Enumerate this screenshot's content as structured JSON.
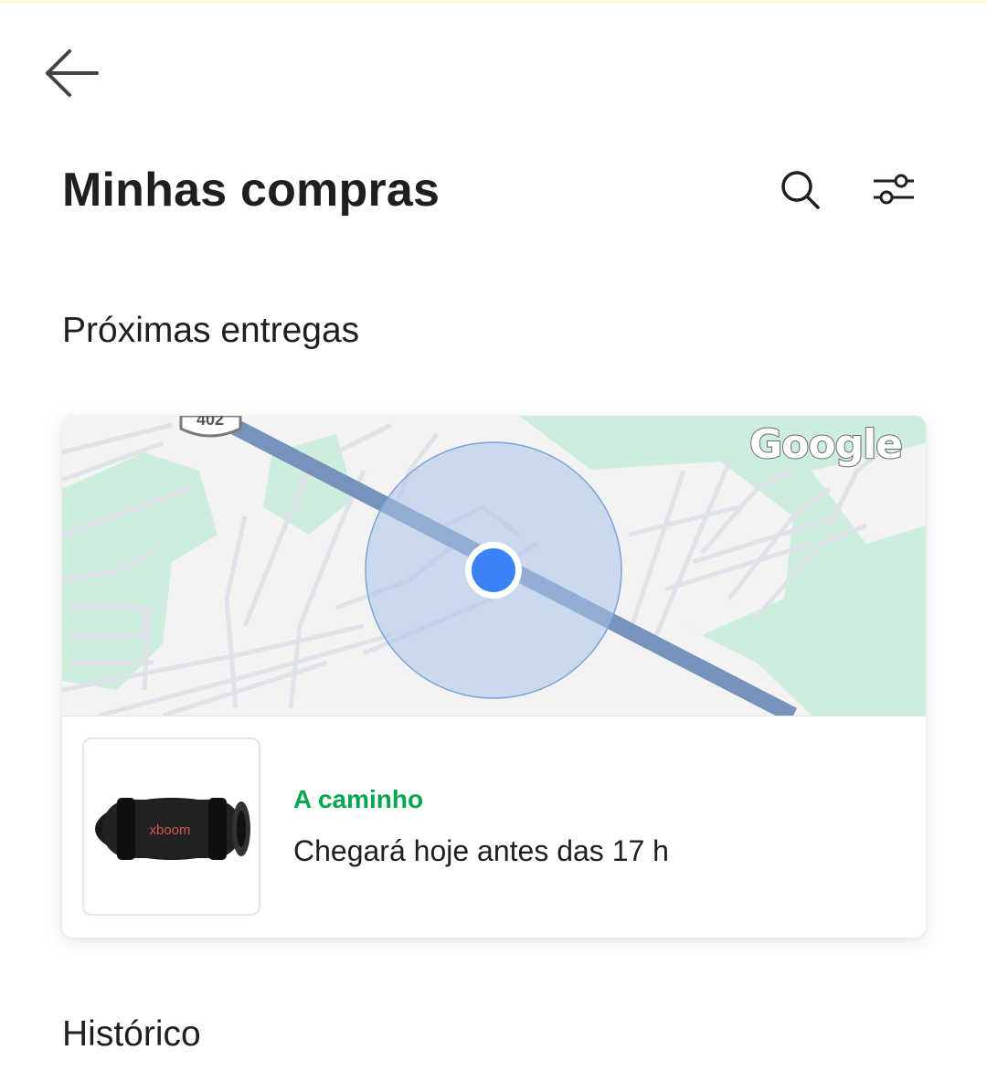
{
  "header": {
    "back_icon": "arrow-left-icon",
    "title": "Minhas compras",
    "search_icon": "search-icon",
    "filter_icon": "sliders-icon"
  },
  "sections": {
    "upcoming_title": "Próximas entregas",
    "history_title": "Histórico"
  },
  "delivery_card": {
    "map": {
      "route_shield": "402",
      "provider_logo": "Google",
      "location_marker_color": "#3b82f6"
    },
    "product": {
      "brand_text": "xboom",
      "image_icon": "portable-speaker-image"
    },
    "status": "A caminho",
    "eta": "Chegará hoje antes das 17 h"
  },
  "colors": {
    "accent_green": "#00a650",
    "text_primary": "#1f1f1f",
    "map_water_green": "#cdeedd",
    "map_road": "#7693bb",
    "accuracy_circle": "#a9c3ea"
  }
}
